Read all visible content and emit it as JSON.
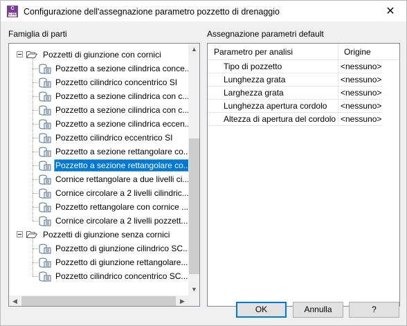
{
  "window": {
    "title": "Configurazione dell'assegnazione parametro pozzetto di drenaggio",
    "app_icon_text": "C",
    "app_icon_sub": "C3D",
    "close_label": "✕"
  },
  "left_panel": {
    "label": "Famiglia di parti",
    "groups": [
      {
        "label": "Pozzetti di giunzione con cornici",
        "items": [
          "Pozzetto a sezione cilindrica conce...",
          "Pozzetto cilindrico concentrico SI",
          "Pozzetto a sezione cilindrica con c...",
          "Pozzetto a sezione cilindrica con c...",
          "Pozzetto a sezione cilindrica eccen...",
          "Pozzetto cilindrico eccentrico SI",
          "Pozzetto a sezione rettangolare co...",
          "Pozzetto a sezione rettangolare co...",
          "Cornice rettangolare a due livelli ci...",
          "Cornice circolare a 2 livelli cilindric...",
          "Pozzetto rettangolare con cornice ...",
          "Cornice circolare a 2 livelli pozzett..."
        ],
        "selected_index": 7
      },
      {
        "label": "Pozzetti di giunzione senza cornici",
        "items": [
          "Pozzetto di giunzione cilindrico SC...",
          "Pozzetto di giunzione rettangolare...",
          "Pozzetto cilindrico concentrico SC..."
        ]
      }
    ]
  },
  "right_panel": {
    "label": "Assegnazione parametri default",
    "columns": [
      "Parametro per analisi",
      "Origine"
    ],
    "rows": [
      {
        "param": "Tipo di pozzetto",
        "origin": "<nessuno>"
      },
      {
        "param": "Lunghezza grata",
        "origin": "<nessuno>"
      },
      {
        "param": "Larghezza grata",
        "origin": "<nessuno>"
      },
      {
        "param": "Lunghezza apertura cordolo",
        "origin": "<nessuno>"
      },
      {
        "param": "Altezza di apertura del cordolo",
        "origin": "<nessuno>"
      }
    ]
  },
  "buttons": {
    "ok": "OK",
    "cancel": "Annulla",
    "help": "?"
  },
  "colors": {
    "selection": "#0078d7",
    "app_icon": "#7a3c95"
  },
  "icons": {
    "scroll_up": "▲",
    "scroll_down": "▼",
    "scroll_left": "◀",
    "scroll_right": "▶"
  }
}
